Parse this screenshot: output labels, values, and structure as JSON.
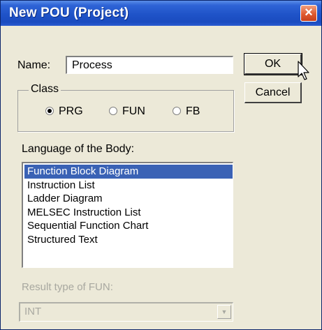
{
  "window": {
    "title": "New POU (Project)"
  },
  "name_field": {
    "label": "Name:",
    "value": "Process"
  },
  "buttons": {
    "ok": "OK",
    "cancel": "Cancel"
  },
  "class_group": {
    "title": "Class",
    "options": [
      "PRG",
      "FUN",
      "FB"
    ],
    "selected": "PRG"
  },
  "language": {
    "label": "Language of the Body:",
    "items": [
      "Function Block Diagram",
      "Instruction List",
      "Ladder Diagram",
      "MELSEC Instruction List",
      "Sequential Function Chart",
      "Structured Text"
    ],
    "selected": "Function Block Diagram"
  },
  "result_type": {
    "label": "Result type of FUN:",
    "value": "INT"
  },
  "icons": [
    "close-icon",
    "radio-selected-icon",
    "radio-unselected-icon",
    "dropdown-arrow-icon",
    "mouse-pointer-icon"
  ]
}
